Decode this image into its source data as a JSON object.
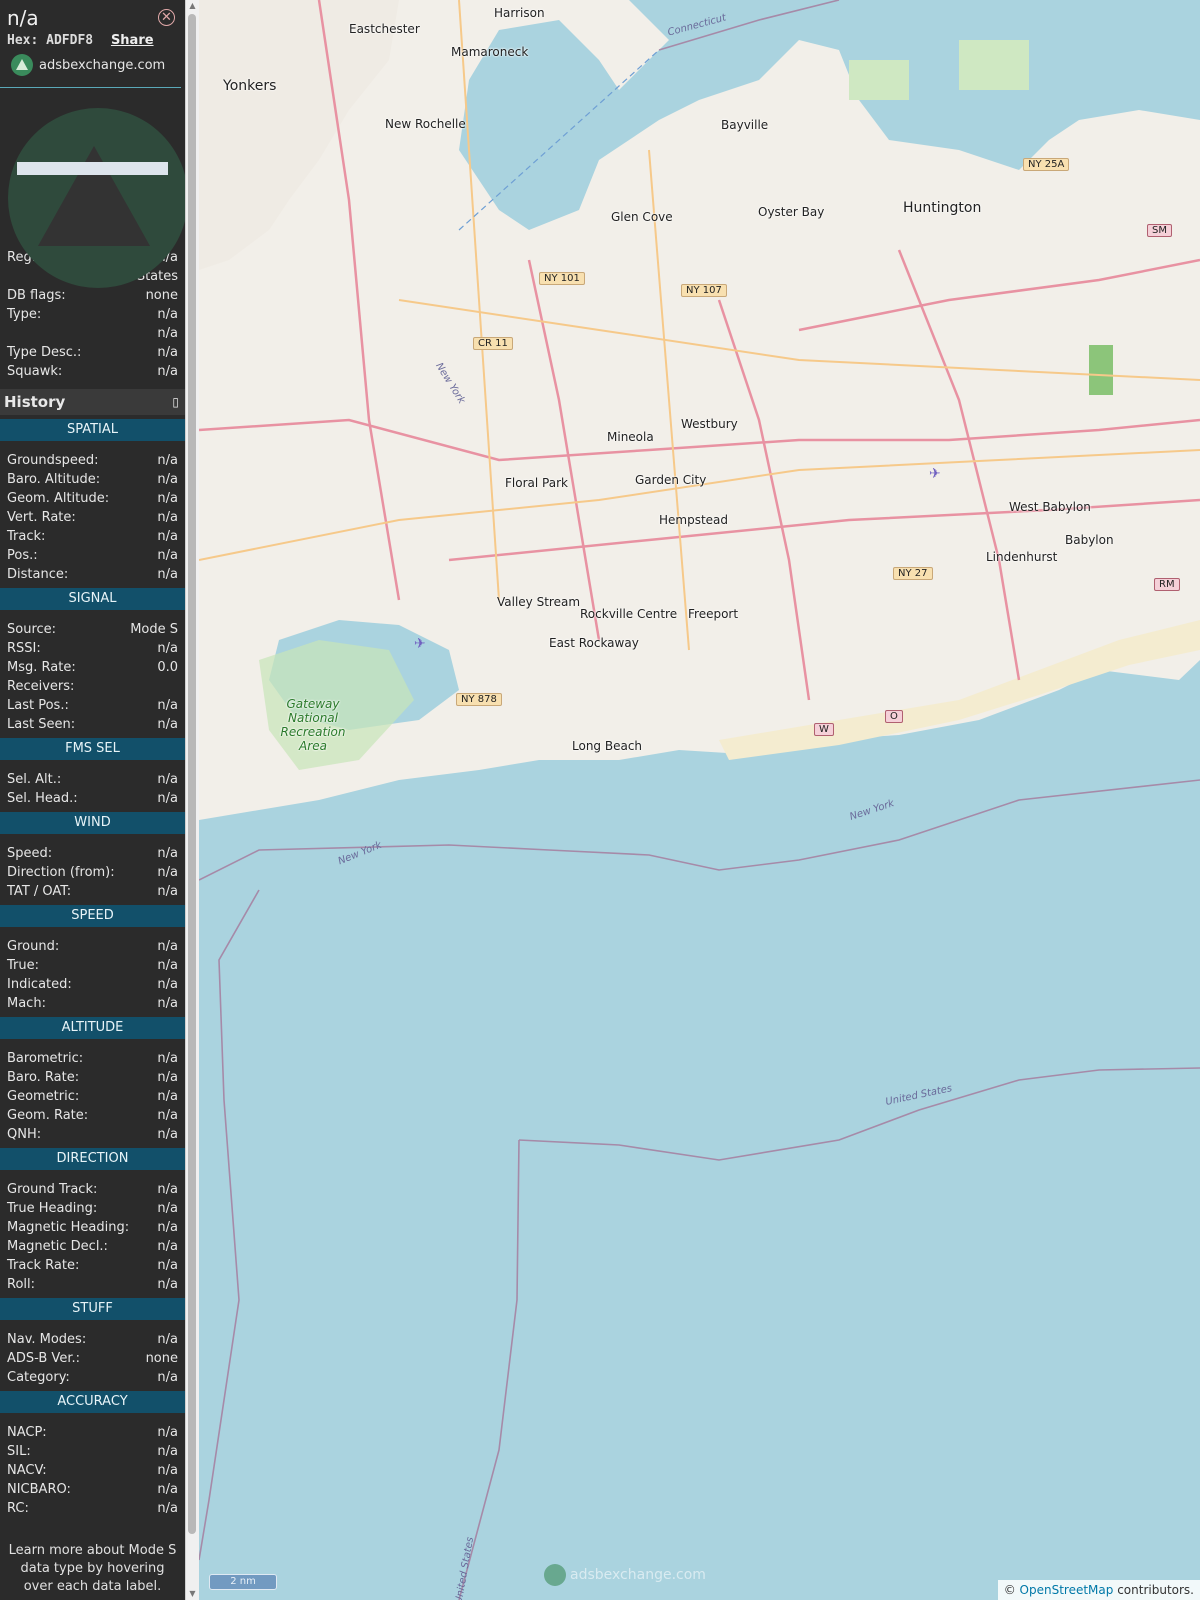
{
  "header": {
    "callsign": "n/a",
    "hex_label": "Hex:",
    "hex": "ADFDF8",
    "share": "Share",
    "source_site": "adsbexchange.com"
  },
  "info_rows": [
    {
      "label": "Reg.:",
      "value": "n/a"
    },
    {
      "label": "",
      "value": "United States"
    },
    {
      "label": "DB flags:",
      "value": "none"
    },
    {
      "label": "Type:",
      "value": "n/a"
    },
    {
      "label": "",
      "value": "n/a"
    },
    {
      "label": "Type Desc.:",
      "value": "n/a"
    },
    {
      "label": "Squawk:",
      "value": "n/a"
    }
  ],
  "history_label": "History",
  "sections": [
    {
      "title": "SPATIAL",
      "rows": [
        {
          "label": "Groundspeed:",
          "value": "n/a"
        },
        {
          "label": "Baro. Altitude:",
          "value": "n/a"
        },
        {
          "label": "Geom. Altitude:",
          "value": "n/a"
        },
        {
          "label": "Vert. Rate:",
          "value": "n/a"
        },
        {
          "label": "Track:",
          "value": "n/a"
        },
        {
          "label": "Pos.:",
          "value": "n/a"
        },
        {
          "label": "Distance:",
          "value": "n/a"
        }
      ]
    },
    {
      "title": "SIGNAL",
      "rows": [
        {
          "label": "Source:",
          "value": "Mode S"
        },
        {
          "label": "RSSI:",
          "value": "n/a"
        },
        {
          "label": "Msg. Rate:",
          "value": "0.0"
        },
        {
          "label": "Receivers:",
          "value": ""
        },
        {
          "label": "Last Pos.:",
          "value": "n/a"
        },
        {
          "label": "Last Seen:",
          "value": "n/a"
        }
      ]
    },
    {
      "title": "FMS SEL",
      "rows": [
        {
          "label": "Sel. Alt.:",
          "value": "n/a"
        },
        {
          "label": "Sel. Head.:",
          "value": "n/a"
        }
      ]
    },
    {
      "title": "WIND",
      "rows": [
        {
          "label": "Speed:",
          "value": "n/a"
        },
        {
          "label": "Direction (from):",
          "value": "n/a"
        },
        {
          "label": "TAT / OAT:",
          "value": "n/a"
        }
      ]
    },
    {
      "title": "SPEED",
      "rows": [
        {
          "label": "Ground:",
          "value": "n/a"
        },
        {
          "label": "True:",
          "value": "n/a"
        },
        {
          "label": "Indicated:",
          "value": "n/a"
        },
        {
          "label": "Mach:",
          "value": "n/a"
        }
      ]
    },
    {
      "title": "ALTITUDE",
      "rows": [
        {
          "label": "Barometric:",
          "value": "n/a"
        },
        {
          "label": "Baro. Rate:",
          "value": "n/a"
        },
        {
          "label": "Geometric:",
          "value": "n/a"
        },
        {
          "label": "Geom. Rate:",
          "value": "n/a"
        },
        {
          "label": "QNH:",
          "value": "n/a"
        }
      ]
    },
    {
      "title": "DIRECTION",
      "rows": [
        {
          "label": "Ground Track:",
          "value": "n/a"
        },
        {
          "label": "True Heading:",
          "value": "n/a"
        },
        {
          "label": "Magnetic Heading:",
          "value": "n/a"
        },
        {
          "label": "Magnetic Decl.:",
          "value": "n/a"
        },
        {
          "label": "Track Rate:",
          "value": "n/a"
        },
        {
          "label": "Roll:",
          "value": "n/a"
        }
      ]
    },
    {
      "title": "STUFF",
      "rows": [
        {
          "label": "Nav. Modes:",
          "value": "n/a"
        },
        {
          "label": "ADS-B Ver.:",
          "value": "none"
        },
        {
          "label": "Category:",
          "value": "n/a"
        }
      ]
    },
    {
      "title": "ACCURACY",
      "rows": [
        {
          "label": "NACP:",
          "value": "n/a"
        },
        {
          "label": "SIL:",
          "value": "n/a"
        },
        {
          "label": "NACV:",
          "value": "n/a"
        },
        {
          "label": "NICBARO:",
          "value": "n/a"
        },
        {
          "label": "RC:",
          "value": "n/a"
        }
      ]
    }
  ],
  "footnote": "Learn more about Mode S data type by hovering over each data label.",
  "map": {
    "scale_label": "2 nm",
    "watermark": "adsbexchange.com",
    "attribution_prefix": "©",
    "attribution_link": "OpenStreetMap",
    "attribution_suffix": "contributors.",
    "places": [
      "Harrison",
      "Eastchester",
      "Mamaroneck",
      "Yonkers",
      "New Rochelle",
      "Bayville",
      "Glen Cove",
      "Oyster Bay",
      "Huntington",
      "Mineola",
      "Westbury",
      "Floral Park",
      "Garden City",
      "Hempstead",
      "West Babylon",
      "Babylon",
      "Lindenhurst",
      "Valley Stream",
      "Rockville Centre",
      "Freeport",
      "East Rockaway",
      "Long Beach",
      "Gateway National Recreation Area"
    ],
    "shields": [
      "NY 101",
      "NY 107",
      "CR 11",
      "NY 25A",
      "SM",
      "NY 27",
      "RM",
      "NY 878",
      "W",
      "O"
    ],
    "water_labels": [
      "Connecticut",
      "New York",
      "New York",
      "New York",
      "United States",
      "United States"
    ]
  }
}
